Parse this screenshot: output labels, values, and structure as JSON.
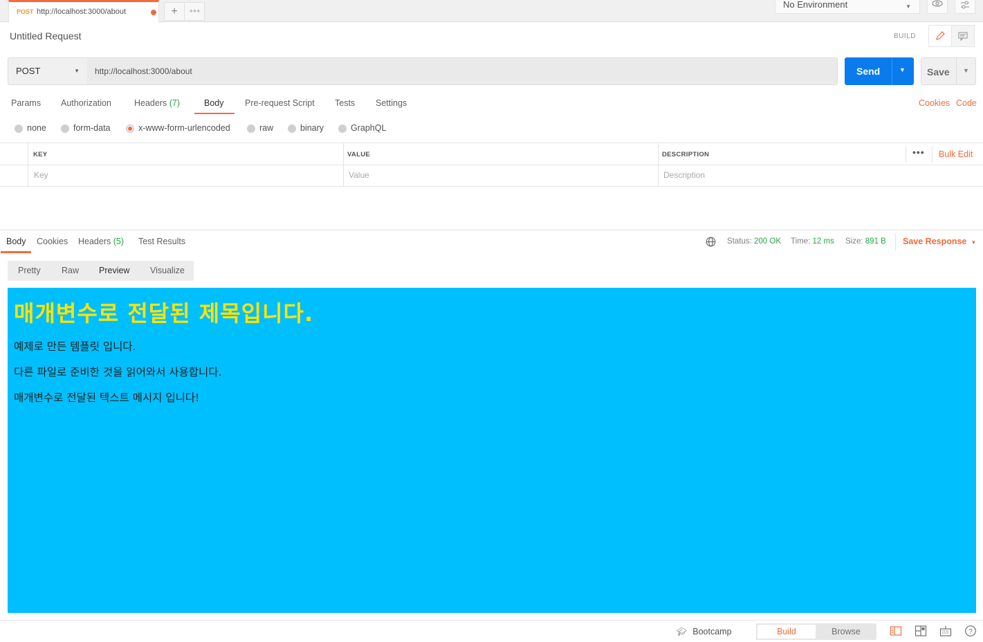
{
  "tabbar": {
    "tab": {
      "method": "POST",
      "url": "http://localhost:3000/about"
    },
    "new_tab_icon": "plus-icon",
    "more_tabs_icon": "more-icon",
    "environment": "No Environment"
  },
  "request": {
    "title": "Untitled Request",
    "build_label": "BUILD",
    "method": "POST",
    "url": "http://localhost:3000/about",
    "send_label": "Send",
    "save_label": "Save"
  },
  "request_tabs": {
    "params": "Params",
    "authorization": "Authorization",
    "headers": "Headers",
    "headers_count": "(7)",
    "body": "Body",
    "pre_request": "Pre-request Script",
    "tests": "Tests",
    "settings": "Settings",
    "cookies": "Cookies",
    "code": "Code"
  },
  "body_types": {
    "none": "none",
    "form_data": "form-data",
    "urlencoded": "x-www-form-urlencoded",
    "raw": "raw",
    "binary": "binary",
    "graphql": "GraphQL",
    "selected": "x-www-form-urlencoded"
  },
  "kv_table": {
    "key_header": "KEY",
    "value_header": "VALUE",
    "description_header": "DESCRIPTION",
    "more": "•••",
    "bulk_edit": "Bulk Edit",
    "key_placeholder": "Key",
    "value_placeholder": "Value",
    "description_placeholder": "Description"
  },
  "response": {
    "tabs": {
      "body": "Body",
      "cookies": "Cookies",
      "headers": "Headers",
      "headers_count": "(5)",
      "test_results": "Test Results"
    },
    "status_label": "Status:",
    "status_value": "200 OK",
    "time_label": "Time:",
    "time_value": "12 ms",
    "size_label": "Size:",
    "size_value": "891 B",
    "save_response": "Save Response",
    "view_tabs": {
      "pretty": "Pretty",
      "raw": "Raw",
      "preview": "Preview",
      "visualize": "Visualize",
      "selected": "Preview"
    },
    "preview": {
      "background": "#00bfff",
      "heading_color": "#ffe300",
      "heading": "매개변수로 전달된 제목입니다.",
      "line1": "예제로 만든 템플릿 입니다.",
      "line2": "다른 파일로 준비한 것을 읽어와서 사용합니다.",
      "line3": "매개변수로 전달된 텍스트 메시지 입니다!"
    }
  },
  "footer": {
    "bootcamp": "Bootcamp",
    "build": "Build",
    "browse": "Browse",
    "icons": [
      "two-pane-icon",
      "layout-icon",
      "keyboard-icon",
      "help-icon"
    ]
  },
  "colors": {
    "accent": "#f26b3a",
    "send_blue": "#097bed",
    "success_green": "#26a645"
  }
}
